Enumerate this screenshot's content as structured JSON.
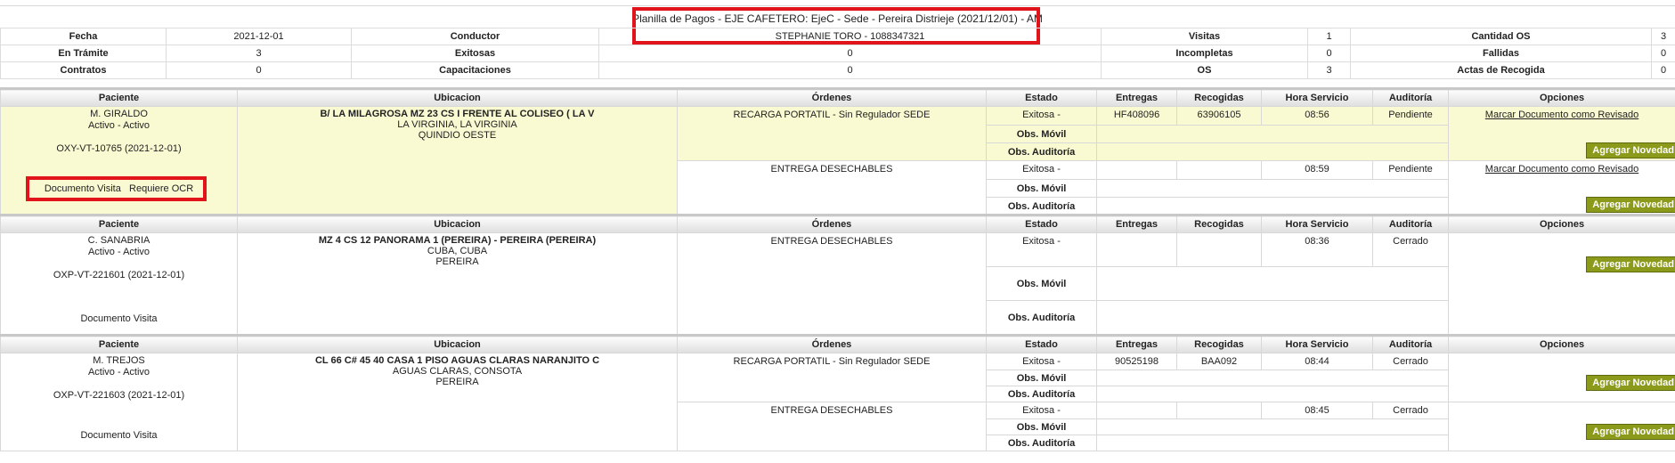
{
  "title": "Planilla de Pagos - EJE CAFETERO: EjeC - Sede - Pereira Distrieje (2021/12/01) - AM",
  "summary": {
    "row1": [
      "Fecha",
      "2021-12-01",
      "Conductor",
      "STEPHANIE TORO - 1088347321",
      "Visitas",
      "1",
      "Cantidad OS",
      "3"
    ],
    "row2": [
      "En Trámite",
      "3",
      "Exitosas",
      "0",
      "Incompletas",
      "0",
      "Fallidas",
      "0"
    ],
    "row3": [
      "Contratos",
      "0",
      "Capacitaciones",
      "0",
      "OS",
      "3",
      "Actas de Recogida",
      "0"
    ]
  },
  "headers": [
    "Paciente",
    "Ubicacion",
    "Órdenes",
    "Estado",
    "Entregas",
    "Recogidas",
    "Hora Servicio",
    "Auditoría",
    "Opciones"
  ],
  "labels": {
    "obs_movil": "Obs. Móvil",
    "obs_auditoria": "Obs. Auditoría",
    "add_novelty": "Agregar Novedad",
    "mark_reviewed": "Marcar Documento como Revisado"
  },
  "visits": [
    {
      "name": "M. GIRALDO",
      "status": "Activo - Activo",
      "code": "OXY-VT-10765 (2021-12-01)",
      "doc": "Documento Visita",
      "ocr": "Requiere OCR",
      "addr1": "B/ LA MILAGROSA MZ 23 CS I FRENTE AL COLISEO ( LA V",
      "addr2": "LA VIRGINIA, LA VIRGINIA",
      "addr3": "QUINDIO OESTE",
      "orders": [
        {
          "order": "RECARGA PORTATIL - Sin Regulador SEDE",
          "state": "Exitosa -",
          "deliv": "HF408096",
          "pick": "63906105",
          "time": "08:56",
          "audit": "Pendiente"
        },
        {
          "order": "ENTREGA DESECHABLES",
          "state": "Exitosa -",
          "deliv": "",
          "pick": "",
          "time": "08:59",
          "audit": "Pendiente"
        }
      ]
    },
    {
      "name": "C. SANABRIA",
      "status": "Activo - Activo",
      "code": "OXP-VT-221601 (2021-12-01)",
      "doc": "Documento Visita",
      "addr1": "MZ 4 CS 12 PANORAMA 1 (PEREIRA) - PEREIRA (PEREIRA)",
      "addr2": "CUBA, CUBA",
      "addr3": "PEREIRA",
      "orders": [
        {
          "order": "ENTREGA DESECHABLES",
          "state": "Exitosa -",
          "deliv": "",
          "pick": "",
          "time": "08:36",
          "audit": "Cerrado"
        }
      ]
    },
    {
      "name": "M. TREJOS",
      "status": "Activo - Activo",
      "code": "OXP-VT-221603 (2021-12-01)",
      "doc": "Documento Visita",
      "addr1": "CL 66 C# 45 40 CASA 1 PISO AGUAS CLARAS NARANJITO C",
      "addr2": "AGUAS CLARAS, CONSOTA",
      "addr3": "PEREIRA",
      "orders": [
        {
          "order": "RECARGA PORTATIL - Sin Regulador SEDE",
          "state": "Exitosa -",
          "deliv": "90525198",
          "pick": "BAA092",
          "time": "08:44",
          "audit": "Cerrado"
        },
        {
          "order": "ENTREGA DESECHABLES",
          "state": "Exitosa -",
          "deliv": "",
          "pick": "",
          "time": "08:45",
          "audit": "Cerrado"
        }
      ]
    }
  ]
}
